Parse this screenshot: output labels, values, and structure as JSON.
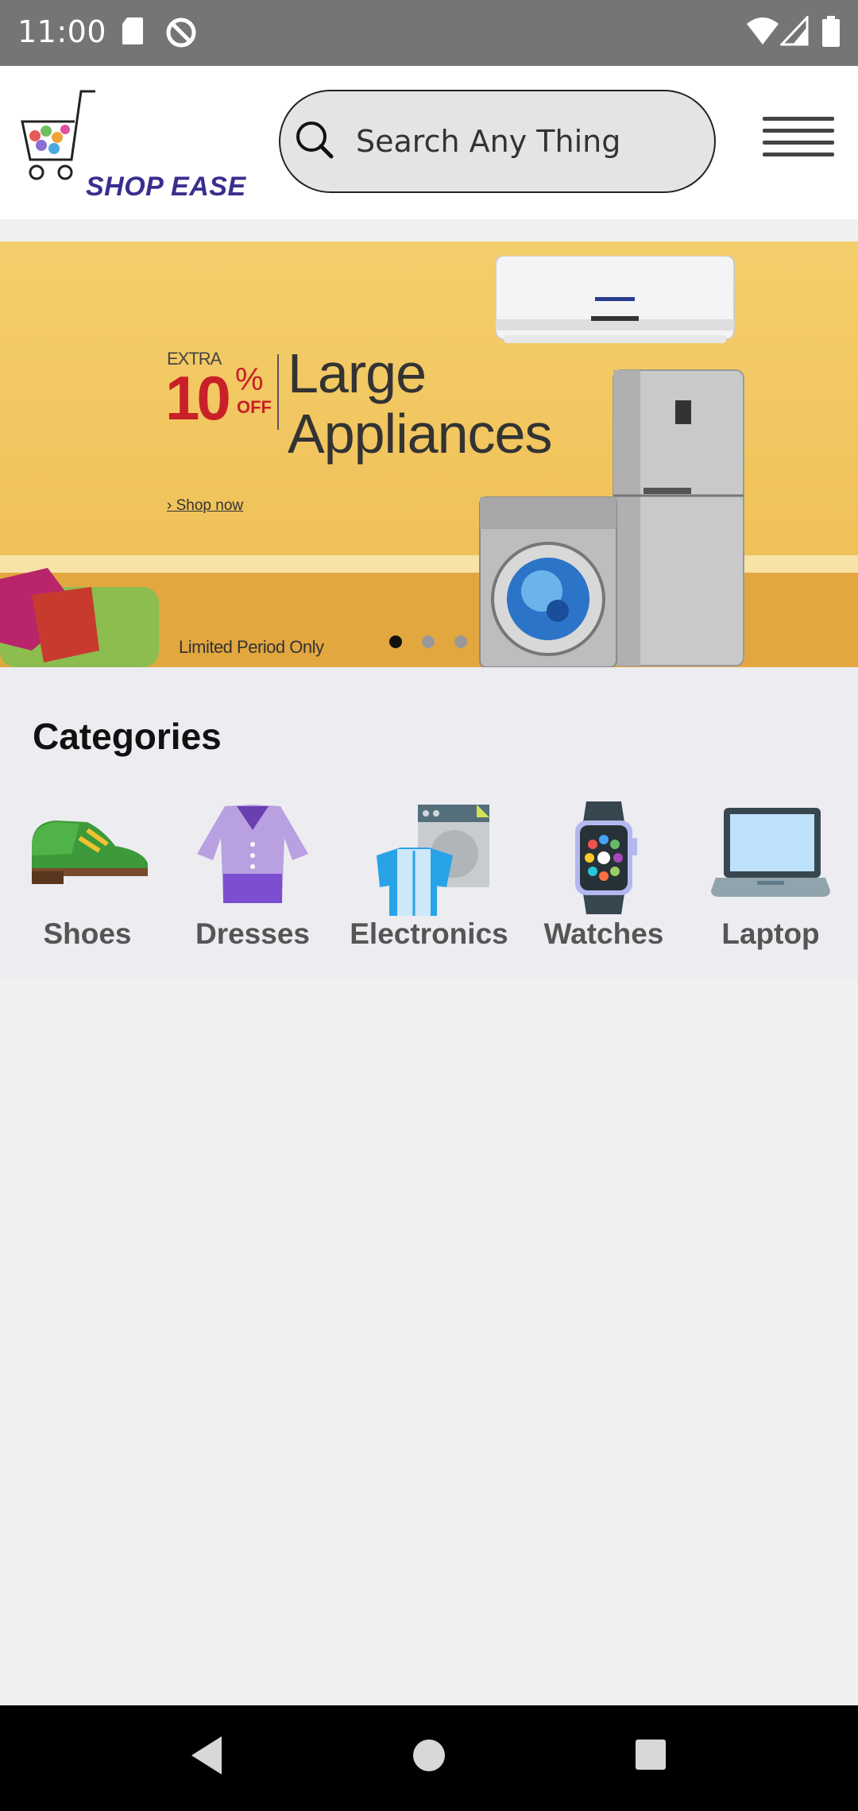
{
  "status_bar": {
    "time": "11:00"
  },
  "header": {
    "logo_text": "SHOP EASE",
    "search_placeholder": "Search Any Thing"
  },
  "banner": {
    "extra": "EXTRA",
    "percent": "10",
    "percent_sign": "%",
    "off": "OFF",
    "headline": "Large Appliances",
    "link": "› Shop now",
    "footnote": "Limited Period Only",
    "slide_count": 3,
    "active_slide": 1
  },
  "categories": {
    "title": "Categories",
    "items": [
      {
        "label": "Shoes",
        "icon": "shoe-icon"
      },
      {
        "label": "Dresses",
        "icon": "dress-icon"
      },
      {
        "label": "Electronics",
        "icon": "electronics-icon"
      },
      {
        "label": "Watches",
        "icon": "watch-icon"
      },
      {
        "label": "Laptop",
        "icon": "laptop-icon"
      }
    ]
  },
  "colors": {
    "status_bar": "#757575",
    "brand": "#3a2f8f",
    "promo_red": "#c82028",
    "banner_yellow": "#f4ce6b"
  }
}
